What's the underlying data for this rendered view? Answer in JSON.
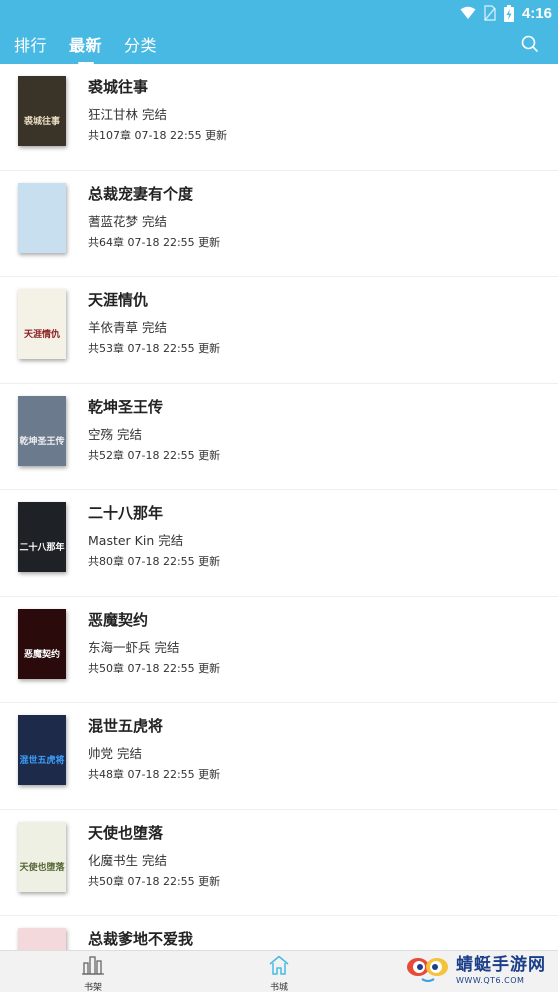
{
  "status": {
    "time": "4:16"
  },
  "header": {
    "tabs": [
      {
        "label": "排行",
        "active": false
      },
      {
        "label": "最新",
        "active": true
      },
      {
        "label": "分类",
        "active": false
      }
    ]
  },
  "books": [
    {
      "title": "裘城往事",
      "author": "狂江甘林 完结",
      "meta": "共107章  07-18 22:55 更新",
      "cover_bg": "#3a3328",
      "cover_fg": "#e8dcc0",
      "cover_text": "裘城往事"
    },
    {
      "title": "总裁宠妻有个度",
      "author": "蓍蓝花梦 完结",
      "meta": "共64章  07-18 22:55 更新",
      "cover_bg": "#c8dff0",
      "cover_fg": "#7a3a6a",
      "cover_text": ""
    },
    {
      "title": "天涯情仇",
      "author": "羊依青草 完结",
      "meta": "共53章  07-18 22:55 更新",
      "cover_bg": "#f4f1e6",
      "cover_fg": "#8a2020",
      "cover_text": "天涯情仇"
    },
    {
      "title": "乾坤圣王传",
      "author": "空殇 完结",
      "meta": "共52章  07-18 22:55 更新",
      "cover_bg": "#6b7a8c",
      "cover_fg": "#f0f0f0",
      "cover_text": "乾坤圣王传"
    },
    {
      "title": "二十八那年",
      "author": "Master Kin 完结",
      "meta": "共80章  07-18 22:55 更新",
      "cover_bg": "#1e2226",
      "cover_fg": "#ffffff",
      "cover_text": "二十八那年"
    },
    {
      "title": "恶魔契约",
      "author": "东海一虾兵 完结",
      "meta": "共50章  07-18 22:55 更新",
      "cover_bg": "#2a0a0a",
      "cover_fg": "#ffffff",
      "cover_text": "恶魔契约"
    },
    {
      "title": "混世五虎将",
      "author": "帅党 完结",
      "meta": "共48章  07-18 22:55 更新",
      "cover_bg": "#1e2a4a",
      "cover_fg": "#3aa0ff",
      "cover_text": "混世五虎将"
    },
    {
      "title": "天使也堕落",
      "author": "化魔书生 完结",
      "meta": "共50章  07-18 22:55 更新",
      "cover_bg": "#eef0e4",
      "cover_fg": "#556633",
      "cover_text": "天使也堕落"
    },
    {
      "title": "总裁爹地不爱我",
      "author": "",
      "meta": "",
      "cover_bg": "#f3d8dc",
      "cover_fg": "#aa3344",
      "cover_text": ""
    }
  ],
  "bottom_nav": [
    {
      "label": "书架",
      "icon": "bookshelf-icon",
      "active": false
    },
    {
      "label": "书城",
      "icon": "home-icon",
      "active": true
    }
  ],
  "watermark": {
    "name": "蜻蜓手游网",
    "url": "WWW.QT6.COM"
  },
  "colors": {
    "accent": "#48b9e3",
    "nav_bg": "#f2f2f2"
  }
}
